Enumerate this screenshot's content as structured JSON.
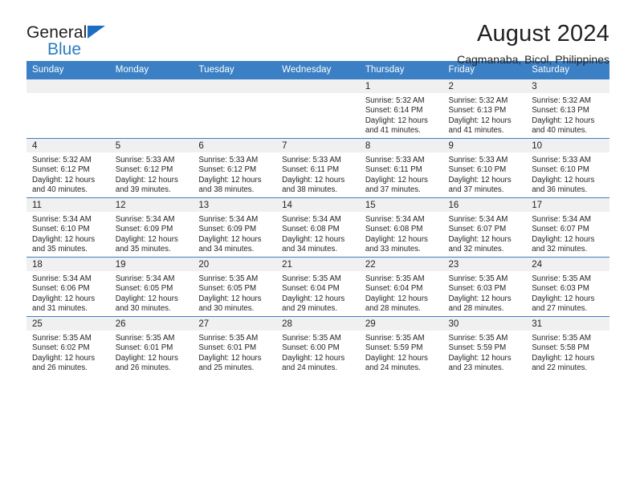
{
  "brand": {
    "name_top": "General",
    "name_bottom": "Blue",
    "triangle_color": "#1b6ec2",
    "blue_color": "#2b7cc3"
  },
  "header": {
    "title": "August 2024",
    "subtitle": "Cagmanaba, Bicol, Philippines"
  },
  "theme": {
    "header_blue": "#3b80c4",
    "daynum_band": "#f0f0f0",
    "text": "#231f20"
  },
  "weekdays": [
    "Sunday",
    "Monday",
    "Tuesday",
    "Wednesday",
    "Thursday",
    "Friday",
    "Saturday"
  ],
  "labels": {
    "sunrise_prefix": "Sunrise:",
    "sunset_prefix": "Sunset:",
    "daylight_prefix": "Daylight:"
  },
  "weeks": [
    [
      {
        "day": "",
        "empty": true
      },
      {
        "day": "",
        "empty": true
      },
      {
        "day": "",
        "empty": true
      },
      {
        "day": "",
        "empty": true
      },
      {
        "day": "1",
        "sunrise": "Sunrise: 5:32 AM",
        "sunset": "Sunset: 6:14 PM",
        "daylight": "Daylight: 12 hours and 41 minutes."
      },
      {
        "day": "2",
        "sunrise": "Sunrise: 5:32 AM",
        "sunset": "Sunset: 6:13 PM",
        "daylight": "Daylight: 12 hours and 41 minutes."
      },
      {
        "day": "3",
        "sunrise": "Sunrise: 5:32 AM",
        "sunset": "Sunset: 6:13 PM",
        "daylight": "Daylight: 12 hours and 40 minutes."
      }
    ],
    [
      {
        "day": "4",
        "sunrise": "Sunrise: 5:32 AM",
        "sunset": "Sunset: 6:12 PM",
        "daylight": "Daylight: 12 hours and 40 minutes."
      },
      {
        "day": "5",
        "sunrise": "Sunrise: 5:33 AM",
        "sunset": "Sunset: 6:12 PM",
        "daylight": "Daylight: 12 hours and 39 minutes."
      },
      {
        "day": "6",
        "sunrise": "Sunrise: 5:33 AM",
        "sunset": "Sunset: 6:12 PM",
        "daylight": "Daylight: 12 hours and 38 minutes."
      },
      {
        "day": "7",
        "sunrise": "Sunrise: 5:33 AM",
        "sunset": "Sunset: 6:11 PM",
        "daylight": "Daylight: 12 hours and 38 minutes."
      },
      {
        "day": "8",
        "sunrise": "Sunrise: 5:33 AM",
        "sunset": "Sunset: 6:11 PM",
        "daylight": "Daylight: 12 hours and 37 minutes."
      },
      {
        "day": "9",
        "sunrise": "Sunrise: 5:33 AM",
        "sunset": "Sunset: 6:10 PM",
        "daylight": "Daylight: 12 hours and 37 minutes."
      },
      {
        "day": "10",
        "sunrise": "Sunrise: 5:33 AM",
        "sunset": "Sunset: 6:10 PM",
        "daylight": "Daylight: 12 hours and 36 minutes."
      }
    ],
    [
      {
        "day": "11",
        "sunrise": "Sunrise: 5:34 AM",
        "sunset": "Sunset: 6:10 PM",
        "daylight": "Daylight: 12 hours and 35 minutes."
      },
      {
        "day": "12",
        "sunrise": "Sunrise: 5:34 AM",
        "sunset": "Sunset: 6:09 PM",
        "daylight": "Daylight: 12 hours and 35 minutes."
      },
      {
        "day": "13",
        "sunrise": "Sunrise: 5:34 AM",
        "sunset": "Sunset: 6:09 PM",
        "daylight": "Daylight: 12 hours and 34 minutes."
      },
      {
        "day": "14",
        "sunrise": "Sunrise: 5:34 AM",
        "sunset": "Sunset: 6:08 PM",
        "daylight": "Daylight: 12 hours and 34 minutes."
      },
      {
        "day": "15",
        "sunrise": "Sunrise: 5:34 AM",
        "sunset": "Sunset: 6:08 PM",
        "daylight": "Daylight: 12 hours and 33 minutes."
      },
      {
        "day": "16",
        "sunrise": "Sunrise: 5:34 AM",
        "sunset": "Sunset: 6:07 PM",
        "daylight": "Daylight: 12 hours and 32 minutes."
      },
      {
        "day": "17",
        "sunrise": "Sunrise: 5:34 AM",
        "sunset": "Sunset: 6:07 PM",
        "daylight": "Daylight: 12 hours and 32 minutes."
      }
    ],
    [
      {
        "day": "18",
        "sunrise": "Sunrise: 5:34 AM",
        "sunset": "Sunset: 6:06 PM",
        "daylight": "Daylight: 12 hours and 31 minutes."
      },
      {
        "day": "19",
        "sunrise": "Sunrise: 5:34 AM",
        "sunset": "Sunset: 6:05 PM",
        "daylight": "Daylight: 12 hours and 30 minutes."
      },
      {
        "day": "20",
        "sunrise": "Sunrise: 5:35 AM",
        "sunset": "Sunset: 6:05 PM",
        "daylight": "Daylight: 12 hours and 30 minutes."
      },
      {
        "day": "21",
        "sunrise": "Sunrise: 5:35 AM",
        "sunset": "Sunset: 6:04 PM",
        "daylight": "Daylight: 12 hours and 29 minutes."
      },
      {
        "day": "22",
        "sunrise": "Sunrise: 5:35 AM",
        "sunset": "Sunset: 6:04 PM",
        "daylight": "Daylight: 12 hours and 28 minutes."
      },
      {
        "day": "23",
        "sunrise": "Sunrise: 5:35 AM",
        "sunset": "Sunset: 6:03 PM",
        "daylight": "Daylight: 12 hours and 28 minutes."
      },
      {
        "day": "24",
        "sunrise": "Sunrise: 5:35 AM",
        "sunset": "Sunset: 6:03 PM",
        "daylight": "Daylight: 12 hours and 27 minutes."
      }
    ],
    [
      {
        "day": "25",
        "sunrise": "Sunrise: 5:35 AM",
        "sunset": "Sunset: 6:02 PM",
        "daylight": "Daylight: 12 hours and 26 minutes."
      },
      {
        "day": "26",
        "sunrise": "Sunrise: 5:35 AM",
        "sunset": "Sunset: 6:01 PM",
        "daylight": "Daylight: 12 hours and 26 minutes."
      },
      {
        "day": "27",
        "sunrise": "Sunrise: 5:35 AM",
        "sunset": "Sunset: 6:01 PM",
        "daylight": "Daylight: 12 hours and 25 minutes."
      },
      {
        "day": "28",
        "sunrise": "Sunrise: 5:35 AM",
        "sunset": "Sunset: 6:00 PM",
        "daylight": "Daylight: 12 hours and 24 minutes."
      },
      {
        "day": "29",
        "sunrise": "Sunrise: 5:35 AM",
        "sunset": "Sunset: 5:59 PM",
        "daylight": "Daylight: 12 hours and 24 minutes."
      },
      {
        "day": "30",
        "sunrise": "Sunrise: 5:35 AM",
        "sunset": "Sunset: 5:59 PM",
        "daylight": "Daylight: 12 hours and 23 minutes."
      },
      {
        "day": "31",
        "sunrise": "Sunrise: 5:35 AM",
        "sunset": "Sunset: 5:58 PM",
        "daylight": "Daylight: 12 hours and 22 minutes."
      }
    ]
  ]
}
